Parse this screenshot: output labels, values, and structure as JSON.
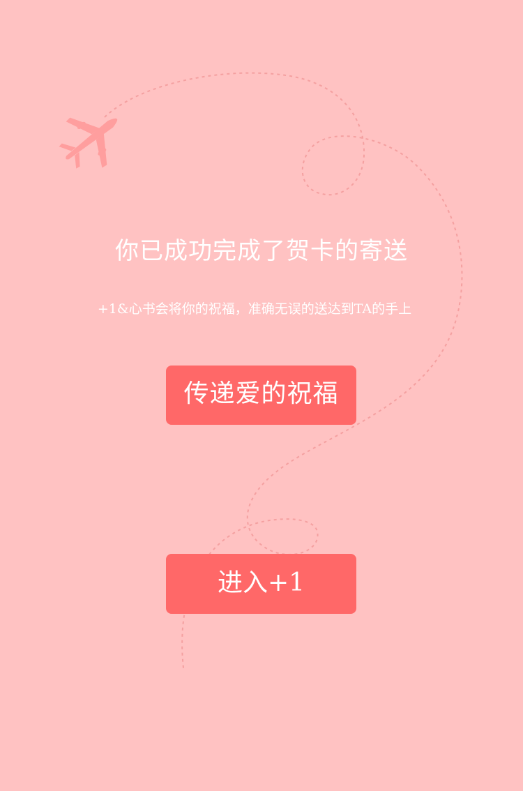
{
  "title": "你已成功完成了贺卡的寄送",
  "subtitle": "+1&心书会将你的祝福，准确无误的送达到TA的手上",
  "buttons": {
    "bless_label": "传递爱的祝福",
    "enter_label": "进入+1"
  },
  "decorations": {
    "plane_icon": "airplane-icon",
    "path": "dashed-flight-path"
  },
  "colors": {
    "background": "#ffc2c2",
    "button": "#ff6868",
    "plane": "#ff9e9e",
    "path": "#f49a9a",
    "text": "#ffffff"
  }
}
